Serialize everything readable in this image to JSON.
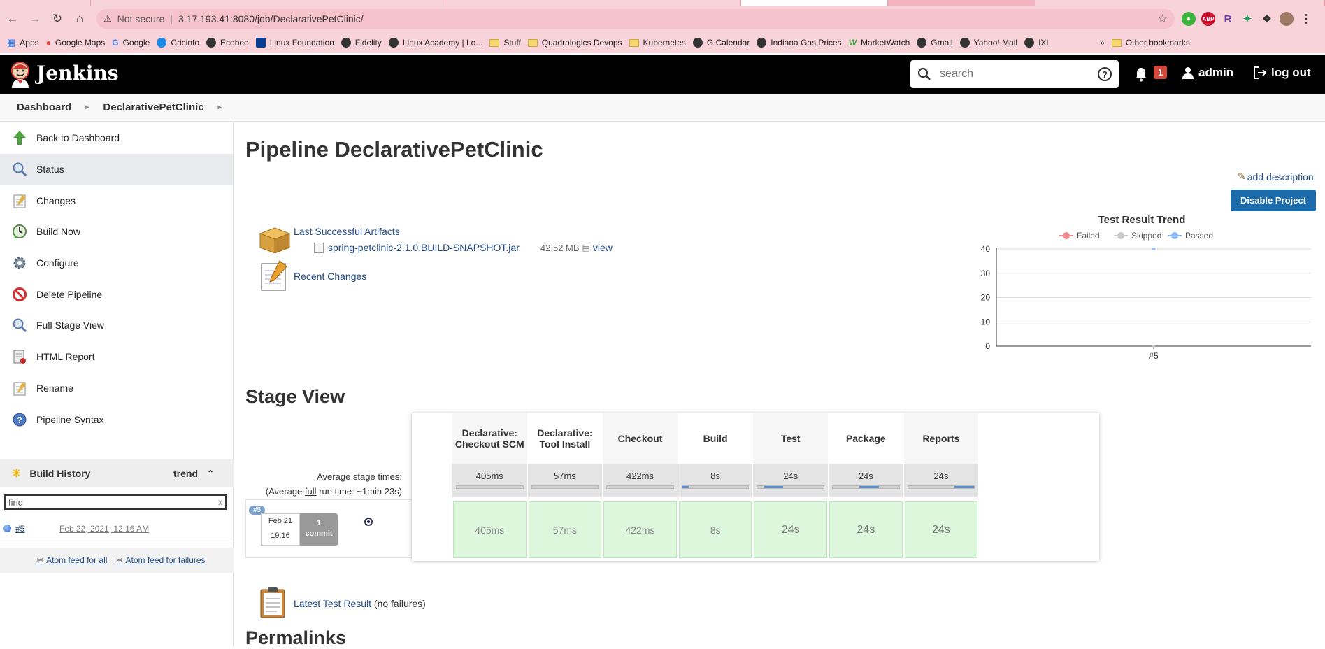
{
  "browser": {
    "security_label": "Not secure",
    "url": "3.17.193.41:8080/job/DeclarativePetClinic/",
    "bookmarks": [
      {
        "label": "Apps",
        "icon": "apps-grid-icon"
      },
      {
        "label": "Google Maps",
        "icon": "maps-pin-icon"
      },
      {
        "label": "Google",
        "icon": "google-icon"
      },
      {
        "label": "Cricinfo",
        "icon": "globe-icon"
      },
      {
        "label": "Ecobee",
        "icon": "globe-icon"
      },
      {
        "label": "Linux Foundation",
        "icon": "globe-icon"
      },
      {
        "label": "Fidelity",
        "icon": "globe-icon"
      },
      {
        "label": "Linux Academy | Lo...",
        "icon": "globe-icon"
      },
      {
        "label": "Stuff",
        "icon": "folder-icon"
      },
      {
        "label": "Quadralogics Devops",
        "icon": "folder-icon"
      },
      {
        "label": "Kubernetes",
        "icon": "folder-icon"
      },
      {
        "label": "G Calendar",
        "icon": "globe-icon"
      },
      {
        "label": "Indiana Gas Prices",
        "icon": "globe-icon"
      },
      {
        "label": "MarketWatch",
        "icon": "marketwatch-icon"
      },
      {
        "label": "Gmail",
        "icon": "globe-icon"
      },
      {
        "label": "Yahoo! Mail",
        "icon": "globe-icon"
      },
      {
        "label": "IXL",
        "icon": "globe-icon"
      }
    ],
    "more_bookmarks": "»",
    "other_bookmarks": "Other bookmarks"
  },
  "header": {
    "title": "Jenkins",
    "search_placeholder": "search",
    "notification_count": "1",
    "user": "admin",
    "logout": "log out"
  },
  "breadcrumb": [
    "Dashboard",
    "DeclarativePetClinic"
  ],
  "sidebar": {
    "tasks": [
      {
        "label": "Back to Dashboard",
        "icon": "up-arrow-icon"
      },
      {
        "label": "Status",
        "icon": "magnifier-icon"
      },
      {
        "label": "Changes",
        "icon": "notepad-icon"
      },
      {
        "label": "Build Now",
        "icon": "build-clock-icon"
      },
      {
        "label": "Configure",
        "icon": "gear-icon"
      },
      {
        "label": "Delete Pipeline",
        "icon": "no-entry-icon"
      },
      {
        "label": "Full Stage View",
        "icon": "magnifier-icon"
      },
      {
        "label": "HTML Report",
        "icon": "report-icon"
      },
      {
        "label": "Rename",
        "icon": "notepad-icon"
      },
      {
        "label": "Pipeline Syntax",
        "icon": "help-icon"
      }
    ],
    "build_history": {
      "title": "Build History",
      "trend": "trend",
      "filter_value": "find",
      "builds": [
        {
          "number": "#5",
          "date": "Feb 22, 2021, 12:16 AM"
        }
      ],
      "feed_all": "Atom feed for all",
      "feed_failures": "Atom feed for failures"
    }
  },
  "main": {
    "title": "Pipeline DeclarativePetClinic",
    "add_description": "add description",
    "disable_button": "Disable Project",
    "artifacts_label": "Last Successful Artifacts",
    "artifact": {
      "name": "spring-petclinic-2.1.0.BUILD-SNAPSHOT.jar",
      "size": "42.52 MB",
      "view": "view"
    },
    "recent_changes": "Recent Changes",
    "stage_view_title": "Stage View",
    "avg_times_label": "Average stage times:",
    "avg_run_prefix": "(Average ",
    "avg_run_full": "full",
    "avg_run_suffix": " run time: ~1min 23s)",
    "latest_test_link": "Latest Test Result",
    "latest_test_note": " (no failures)",
    "permalinks_title": "Permalinks"
  },
  "stages": {
    "columns": [
      {
        "name": "Declarative: Checkout SCM",
        "avg": "405ms",
        "bar_start": 0.0,
        "bar_width": 0.0
      },
      {
        "name": "Declarative: Tool Install",
        "avg": "57ms",
        "bar_start": 0.0,
        "bar_width": 0.0
      },
      {
        "name": "Checkout",
        "avg": "422ms",
        "bar_start": 0.0,
        "bar_width": 0.0
      },
      {
        "name": "Build",
        "avg": "8s",
        "bar_start": 0.0,
        "bar_width": 0.1
      },
      {
        "name": "Test",
        "avg": "24s",
        "bar_start": 0.1,
        "bar_width": 0.29
      },
      {
        "name": "Package",
        "avg": "24s",
        "bar_start": 0.4,
        "bar_width": 0.3
      },
      {
        "name": "Reports",
        "avg": "24s",
        "bar_start": 0.7,
        "bar_width": 0.3
      }
    ],
    "build": {
      "number": "#5",
      "date_line1": "Feb 21",
      "date_line2": "19:16",
      "commits": "1",
      "commit_label": "commit",
      "times": [
        "405ms",
        "57ms",
        "422ms",
        "8s",
        "24s",
        "24s",
        "24s"
      ]
    }
  },
  "chart_data": {
    "type": "line",
    "title": "Test Result Trend",
    "categories": [
      "#5"
    ],
    "series": [
      {
        "name": "Failed",
        "values": [
          0
        ],
        "color": "#f08c8c"
      },
      {
        "name": "Skipped",
        "values": [
          0
        ],
        "color": "#c8c8c8"
      },
      {
        "name": "Passed",
        "values": [
          40
        ],
        "color": "#88b8f5"
      }
    ],
    "ylim": [
      0,
      40
    ],
    "yticks": [
      0,
      10,
      20,
      30,
      40
    ],
    "grid": true,
    "legend": "top"
  }
}
